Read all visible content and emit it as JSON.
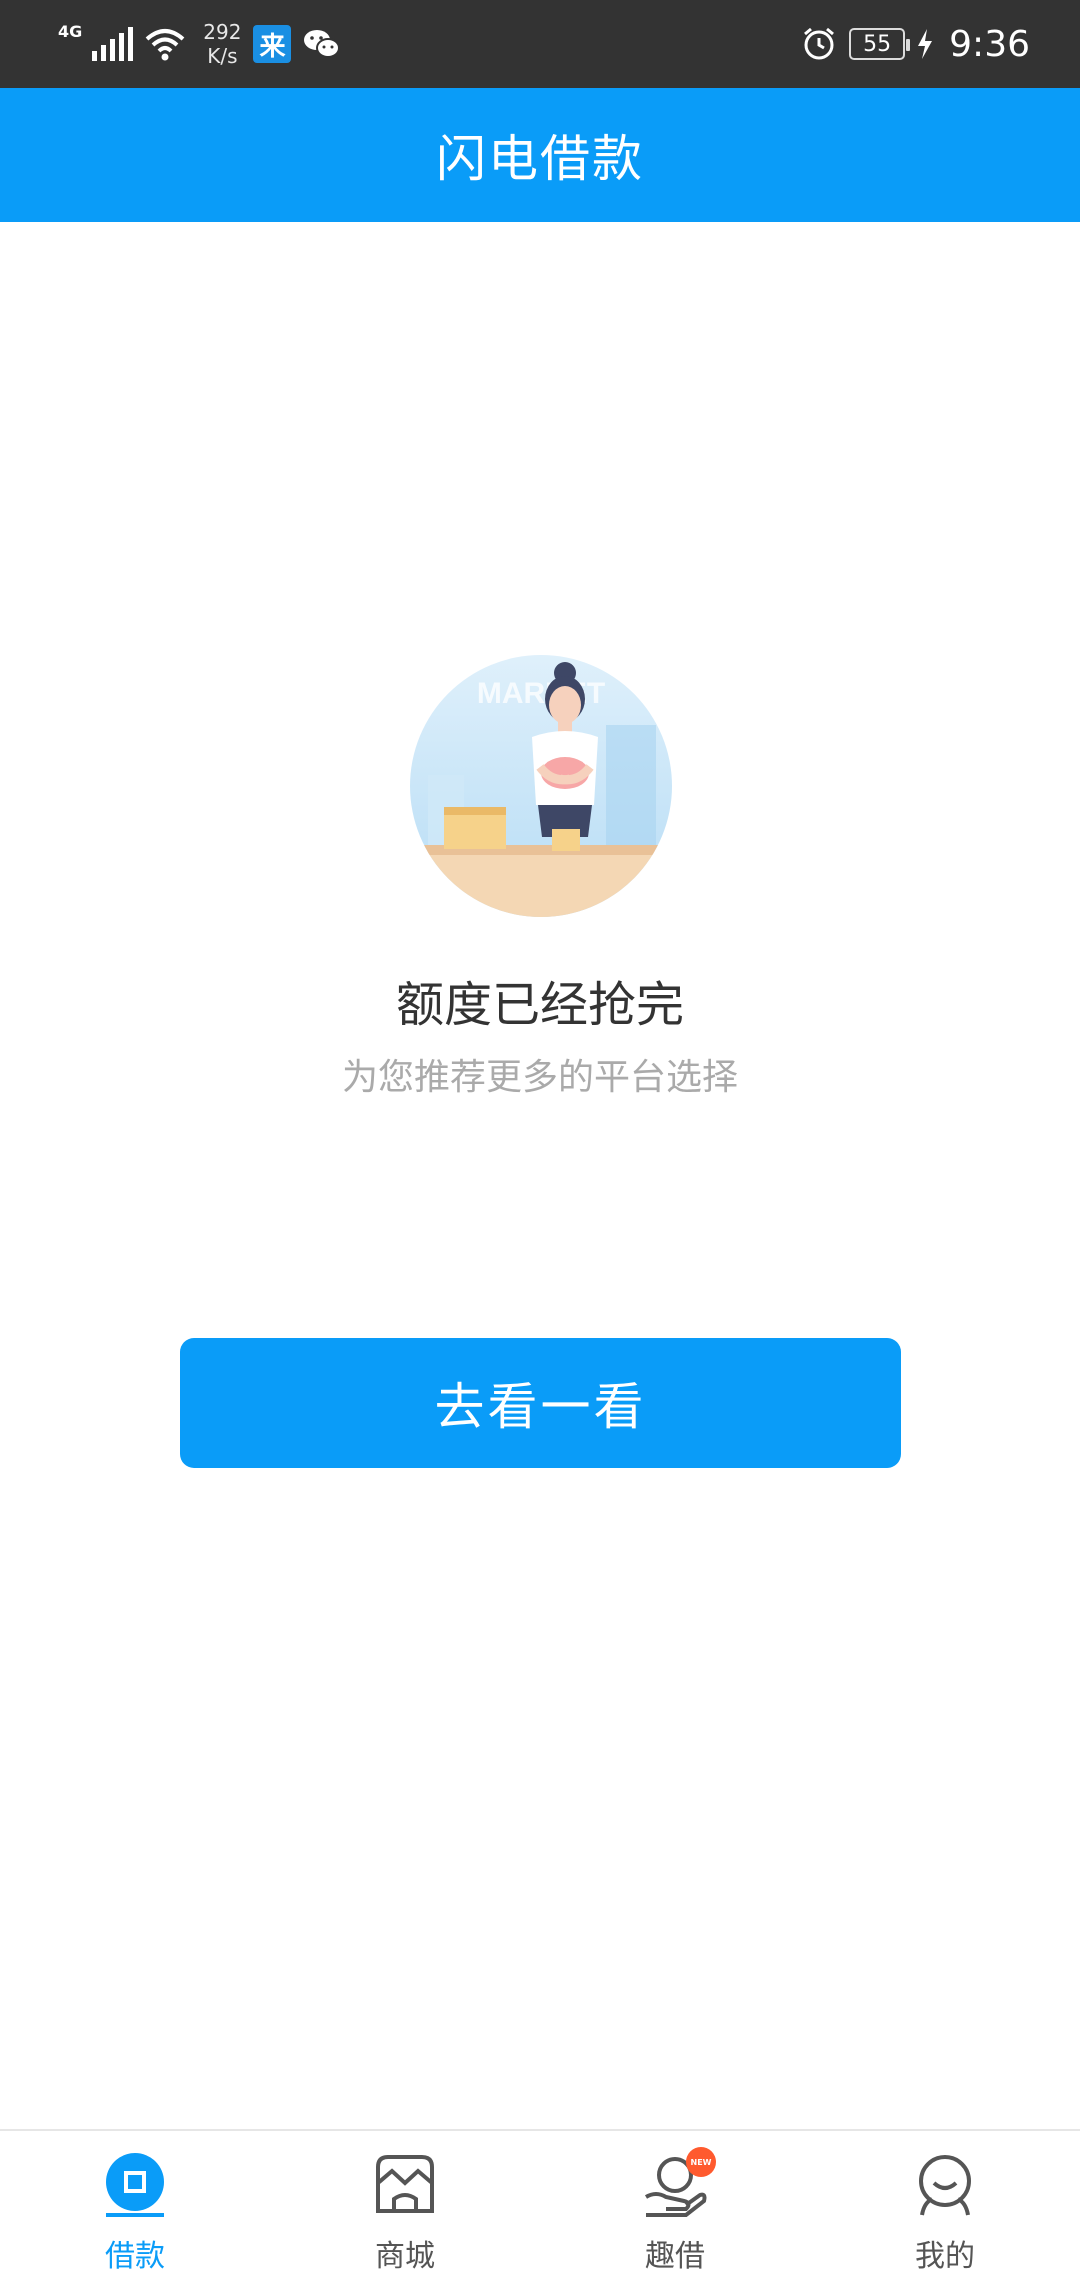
{
  "status_bar": {
    "network": "4G",
    "speed_value": "292",
    "speed_unit": "K/s",
    "app_badge": "来",
    "battery": "55",
    "time": "9:36",
    "icons": [
      "signal-icon",
      "wifi-icon",
      "app-badge-icon",
      "wechat-icon",
      "alarm-icon",
      "battery-icon",
      "charging-icon"
    ]
  },
  "header": {
    "title": "闪电借款"
  },
  "main": {
    "illustration_text": "MARKET",
    "title": "额度已经抢完",
    "subtitle": "为您推荐更多的平台选择",
    "button_label": "去看一看"
  },
  "bottom_nav": {
    "items": [
      {
        "label": "借款",
        "icon": "loan-icon",
        "active": true
      },
      {
        "label": "商城",
        "icon": "store-icon",
        "active": false
      },
      {
        "label": "趣借",
        "icon": "hand-coin-icon",
        "active": false,
        "badge": "NEW"
      },
      {
        "label": "我的",
        "icon": "profile-icon",
        "active": false
      }
    ]
  },
  "colors": {
    "primary": "#0a9cf8",
    "status_bar": "#333333",
    "title_text": "#333333",
    "subtitle_text": "#aaaaaa"
  }
}
